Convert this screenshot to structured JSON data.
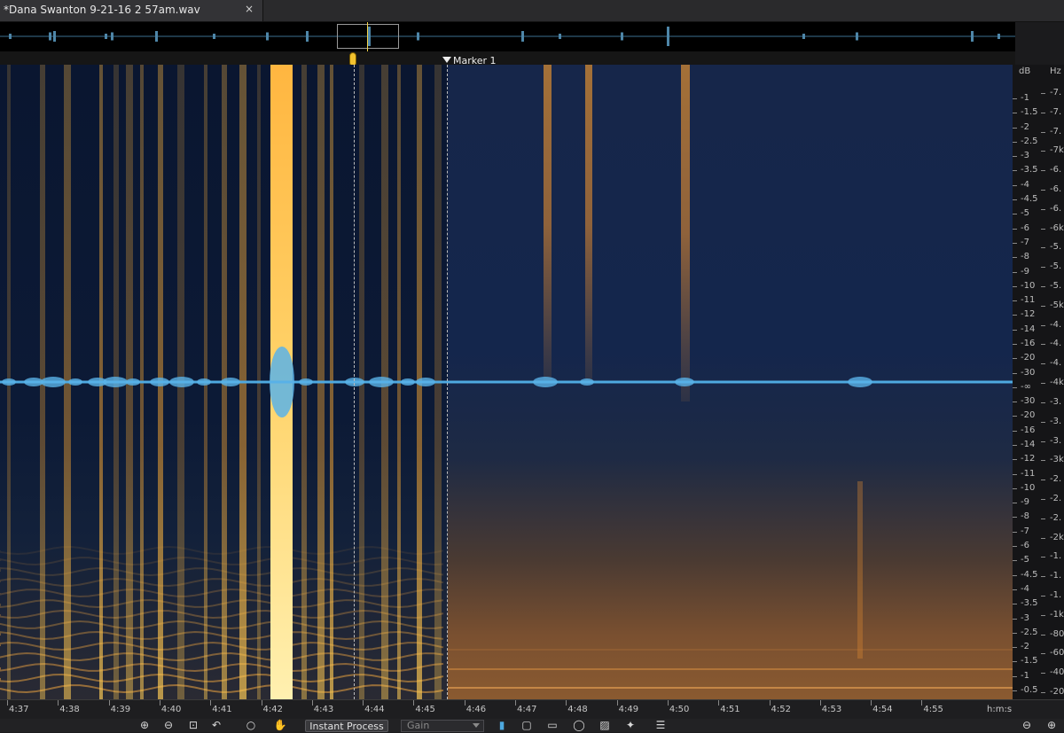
{
  "tab": {
    "title": "*Dana Swanton 9-21-16  2 57am.wav",
    "close_glyph": "×"
  },
  "marker": {
    "label": "Marker 1"
  },
  "db_ruler": {
    "header": "dB",
    "labels": [
      "-1",
      "-1.5",
      "-2",
      "-2.5",
      "-3",
      "-3.5",
      "-4",
      "-4.5",
      "-5",
      "-6",
      "-7",
      "-8",
      "-9",
      "-10",
      "-11",
      "-12",
      "-14",
      "-16",
      "-20",
      "-30",
      "-∞",
      "-30",
      "-20",
      "-16",
      "-14",
      "-12",
      "-11",
      "-10",
      "-9",
      "-8",
      "-7",
      "-6",
      "-5",
      "-4.5",
      "-4",
      "-3.5",
      "-3",
      "-2.5",
      "-2",
      "-1.5",
      "-1",
      "-0.5"
    ]
  },
  "hz_ruler": {
    "header": "Hz",
    "labels": [
      "-7.",
      "-7.",
      "-7.",
      "-7k",
      "-6.",
      "-6.",
      "-6.",
      "-6k",
      "-5.",
      "-5.",
      "-5.",
      "-5k",
      "-4.",
      "-4.",
      "-4.",
      "-4k",
      "-3.",
      "-3.",
      "-3.",
      "-3k",
      "-2.",
      "-2.",
      "-2.",
      "-2k",
      "-1.",
      "-1.",
      "-1.",
      "-1k",
      "-80",
      "-60",
      "-40",
      "-20"
    ]
  },
  "timeline": {
    "labels": [
      "4:37",
      "4:38",
      "4:39",
      "4:40",
      "4:41",
      "4:42",
      "4:43",
      "4:44",
      "4:45",
      "4:46",
      "4:47",
      "4:48",
      "4:49",
      "4:50",
      "4:51",
      "4:52",
      "4:53",
      "4:54",
      "4:55"
    ],
    "unit": "h:m:s"
  },
  "toolbar": {
    "zoom_in_icon": "zoom-in-icon",
    "zoom_out_icon": "zoom-out-icon",
    "instant_process_label": "Instant Process",
    "gain_label": "Gain"
  },
  "colors": {
    "waveform": "#4ea9e0",
    "spectrum_hot": "#f0b040",
    "spectrum_cool": "#0b1630"
  }
}
